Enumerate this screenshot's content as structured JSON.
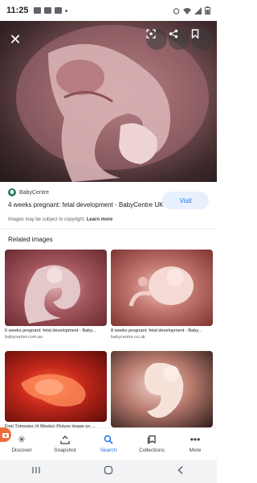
{
  "status_bar": {
    "time": "11:25"
  },
  "hero": {
    "close_icon": "close-icon",
    "lens_icon": "lens-icon",
    "share_icon": "share-icon",
    "save_icon": "bookmark-icon"
  },
  "source": {
    "name": "BabyCentre",
    "title": "4 weeks pregnant: fetal development - BabyCentre UK",
    "visit_label": "Visit",
    "copyright_text": "Images may be subject to copyright.",
    "learn_more": "Learn more"
  },
  "related": {
    "label": "Related images",
    "items": [
      {
        "caption": "6 weeks pregnant: fetal development - Baby...",
        "source": "babycenter.com.au"
      },
      {
        "caption": "8 weeks pregnant: fetal development - Baby...",
        "source": "babycentre.co.uk"
      },
      {
        "caption": "First Trimester (4 Weeks) Picture Image on ...",
        "source": ""
      },
      {
        "caption": "",
        "source": ""
      }
    ]
  },
  "bottom_nav": {
    "items": [
      {
        "label": "Discover",
        "icon": "asterisk-icon"
      },
      {
        "label": "Snapshot",
        "icon": "snapshot-icon"
      },
      {
        "label": "Search",
        "icon": "search-icon"
      },
      {
        "label": "Collections",
        "icon": "collections-icon"
      },
      {
        "label": "More",
        "icon": "more-icon"
      }
    ],
    "active": "Search"
  },
  "colors": {
    "accent": "#1a73e8",
    "visit_bg": "#e8f0fe",
    "badge": "#ef6c3a"
  }
}
